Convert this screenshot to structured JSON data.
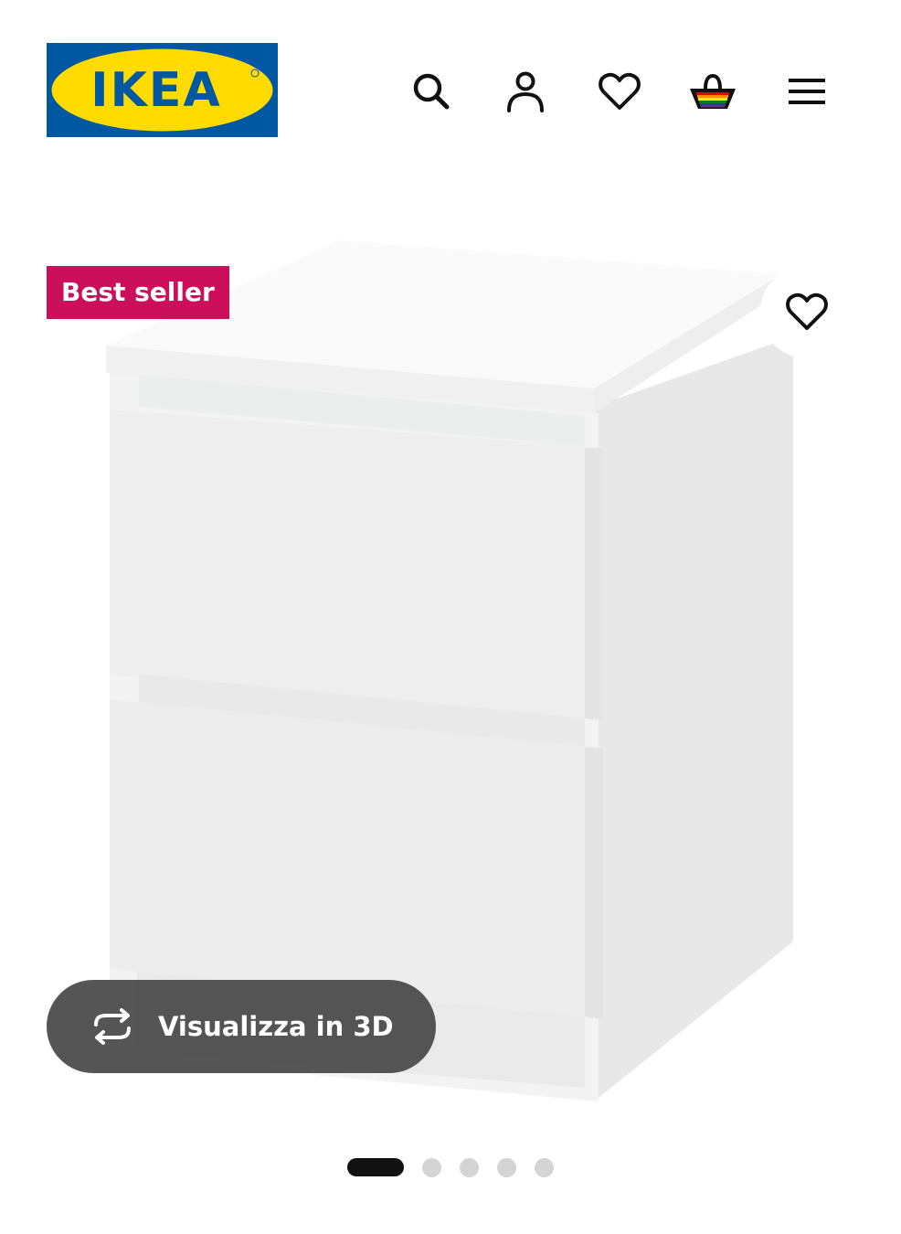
{
  "header": {
    "logo_text": "IKEA",
    "logo_colors": {
      "background": "#0058a3",
      "oval": "#ffdb00",
      "text": "#0058a3"
    },
    "icons": [
      {
        "name": "search-icon"
      },
      {
        "name": "account-icon"
      },
      {
        "name": "wishlist-icon"
      },
      {
        "name": "shopping-bag-icon"
      },
      {
        "name": "menu-icon"
      }
    ]
  },
  "product": {
    "badge": "Best seller",
    "badge_color": "#cc0f5b",
    "favorite_icon": "heart-icon",
    "view_3d_label": "Visualizza in 3D",
    "view_3d_icon": "rotate-3d-icon"
  },
  "carousel": {
    "total": 5,
    "active_index": 0
  }
}
